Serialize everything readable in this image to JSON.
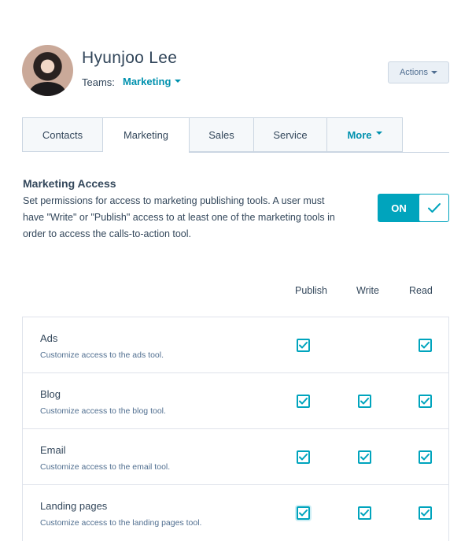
{
  "user": {
    "name": "Hyunjoo Lee",
    "teams_label": "Teams:",
    "team": "Marketing"
  },
  "actions_label": "Actions",
  "tabs": [
    {
      "label": "Contacts",
      "active": false
    },
    {
      "label": "Marketing",
      "active": true
    },
    {
      "label": "Sales",
      "active": false
    },
    {
      "label": "Service",
      "active": false
    },
    {
      "label": "More",
      "active": false
    }
  ],
  "section": {
    "title": "Marketing Access",
    "description": "Set permissions for access to marketing publishing tools. A user must have \"Write\" or \"Publish\" access to at least one of the marketing tools in order to access the calls-to-action tool."
  },
  "toggle": {
    "label": "ON",
    "state": "on"
  },
  "columns": [
    "Publish",
    "Write",
    "Read"
  ],
  "rows": [
    {
      "title": "Ads",
      "description": "Customize access to the ads tool.",
      "publish": true,
      "write": null,
      "read": true
    },
    {
      "title": "Blog",
      "description": "Customize access to the blog tool.",
      "publish": true,
      "write": true,
      "read": true
    },
    {
      "title": "Email",
      "description": "Customize access to the email tool.",
      "publish": true,
      "write": true,
      "read": true
    },
    {
      "title": "Landing pages",
      "description": "Customize access to the landing pages tool.",
      "publish": true,
      "write": true,
      "read": true
    }
  ],
  "colors": {
    "accent": "#00a4bd",
    "link": "#0091ae",
    "text": "#33475b",
    "border": "#cbd6e2"
  }
}
